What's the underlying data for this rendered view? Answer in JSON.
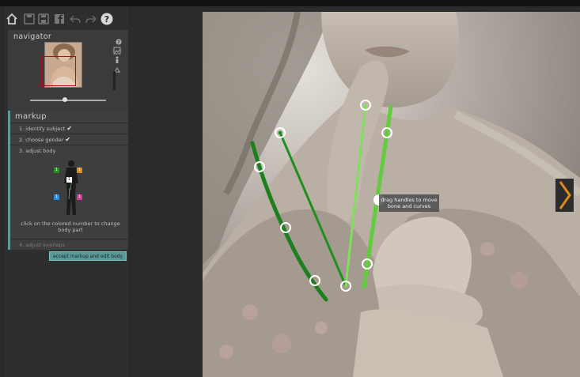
{
  "navigator": {
    "title": "navigator"
  },
  "markup": {
    "title": "markup",
    "steps": [
      {
        "label": "1. identify subject",
        "done": true
      },
      {
        "label": "2. choose gender",
        "done": true
      },
      {
        "label": "3. adjust body",
        "done": false
      },
      {
        "label": "4. adjust overlaps",
        "done": false
      }
    ],
    "hint": "click on the colored number to change body part",
    "numbers": [
      {
        "label": "1",
        "color": "#2d8a2d"
      },
      {
        "label": "1",
        "color": "#e08a1b"
      },
      {
        "label": "1",
        "color": "#2e8bd1"
      },
      {
        "label": "1",
        "color": "#d63a9a"
      },
      {
        "label": "1",
        "color": "#ffffff"
      }
    ],
    "accept_label": "accept markup and edit body"
  },
  "canvas": {
    "tooltip": "drag handles to move bone and curves"
  },
  "colors": {
    "accent": "#5f9a9a",
    "bone_dark": "#1f8a1f",
    "bone_light": "#6fdc4c"
  },
  "icons": [
    "home-icon",
    "save-icon",
    "save-as-icon",
    "facebook-icon",
    "undo-icon",
    "redo-icon",
    "help-icon",
    "next-arrow-icon"
  ]
}
